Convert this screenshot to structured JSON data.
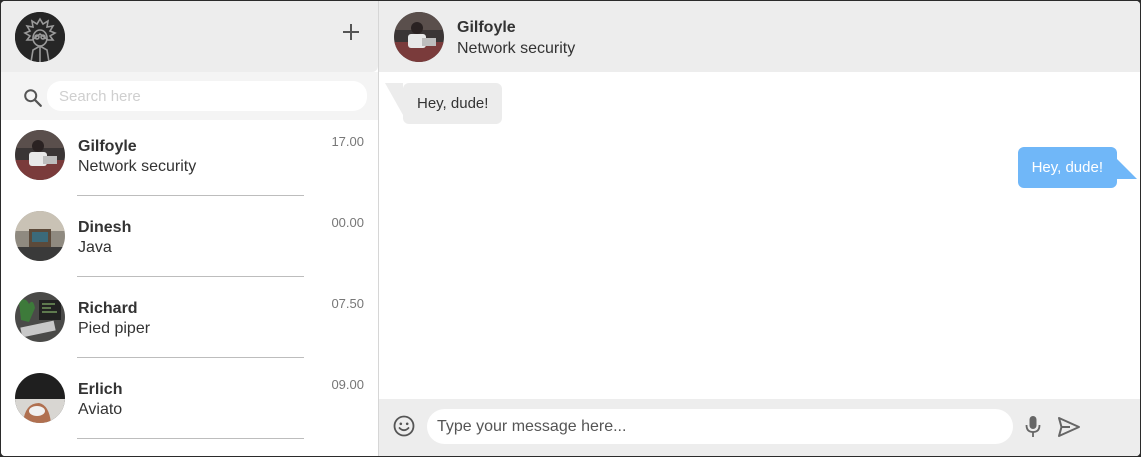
{
  "sidebar": {
    "me": {
      "avatar_icon": "user-avatar-icon"
    },
    "new_chat_icon": "plus-icon",
    "search": {
      "placeholder": "Search here",
      "value": "",
      "icon": "search-icon"
    },
    "contacts": [
      {
        "name": "Gilfoyle",
        "message": "Network security",
        "time": "17.00"
      },
      {
        "name": "Dinesh",
        "message": "Java",
        "time": "00.00"
      },
      {
        "name": "Richard",
        "message": "Pied piper",
        "time": "07.50"
      },
      {
        "name": "Erlich",
        "message": "Aviato",
        "time": "09.00"
      }
    ]
  },
  "chat": {
    "header": {
      "name": "Gilfoyle",
      "status": "Network security"
    },
    "messages": [
      {
        "direction": "in",
        "text": "Hey, dude!"
      },
      {
        "direction": "out",
        "text": "Hey, dude!"
      }
    ],
    "composer": {
      "placeholder": "Type your message here...",
      "value": "",
      "emoji_icon": "emoji-icon",
      "mic_icon": "microphone-icon",
      "send_icon": "send-icon"
    }
  },
  "colors": {
    "header_bg": "#ededed",
    "outgoing_bubble": "#70b7f8",
    "incoming_bubble": "#ececec"
  }
}
